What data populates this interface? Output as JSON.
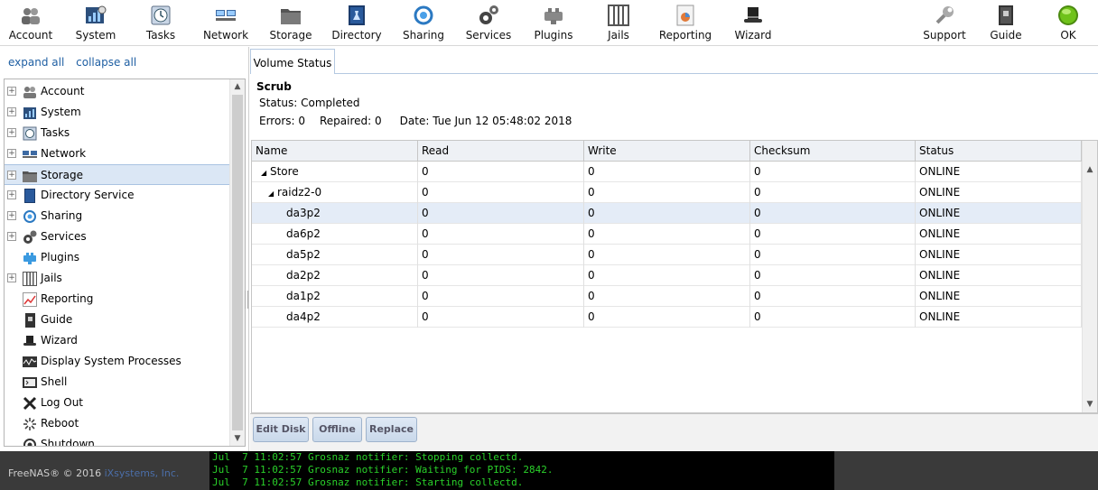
{
  "toolbar": {
    "items": [
      {
        "label": "Account",
        "icon": "account-icon"
      },
      {
        "label": "System",
        "icon": "system-icon"
      },
      {
        "label": "Tasks",
        "icon": "tasks-icon"
      },
      {
        "label": "Network",
        "icon": "network-icon"
      },
      {
        "label": "Storage",
        "icon": "storage-icon"
      },
      {
        "label": "Directory",
        "icon": "directory-icon"
      },
      {
        "label": "Sharing",
        "icon": "sharing-icon"
      },
      {
        "label": "Services",
        "icon": "services-icon"
      },
      {
        "label": "Plugins",
        "icon": "plugins-icon"
      },
      {
        "label": "Jails",
        "icon": "jails-icon"
      },
      {
        "label": "Reporting",
        "icon": "reporting-icon"
      },
      {
        "label": "Wizard",
        "icon": "wizard-icon"
      },
      {
        "label": "Support",
        "icon": "support-icon"
      },
      {
        "label": "Guide",
        "icon": "guide-icon"
      },
      {
        "label": "OK",
        "icon": "status-ok-icon"
      }
    ]
  },
  "sidebar": {
    "expand_all": "expand all",
    "collapse_all": "collapse all",
    "items": [
      {
        "label": "Account",
        "expandable": "+"
      },
      {
        "label": "System",
        "expandable": "+"
      },
      {
        "label": "Tasks",
        "expandable": "+"
      },
      {
        "label": "Network",
        "expandable": "+"
      },
      {
        "label": "Storage",
        "expandable": "+"
      },
      {
        "label": "Directory Service",
        "expandable": "+"
      },
      {
        "label": "Sharing",
        "expandable": "+"
      },
      {
        "label": "Services",
        "expandable": "+"
      },
      {
        "label": "Plugins",
        "expandable": ""
      },
      {
        "label": "Jails",
        "expandable": "+"
      },
      {
        "label": "Reporting",
        "expandable": ""
      },
      {
        "label": "Guide",
        "expandable": ""
      },
      {
        "label": "Wizard",
        "expandable": ""
      },
      {
        "label": "Display System Processes",
        "expandable": ""
      },
      {
        "label": "Shell",
        "expandable": ""
      },
      {
        "label": "Log Out",
        "expandable": ""
      },
      {
        "label": "Reboot",
        "expandable": ""
      },
      {
        "label": "Shutdown",
        "expandable": ""
      }
    ],
    "selected": "Storage"
  },
  "main": {
    "tab_label": "Volume Status",
    "scrub": {
      "title": "Scrub",
      "status": "Status: Completed",
      "errors": "Errors: 0",
      "repaired": "Repaired: 0",
      "date": "Date: Tue Jun 12 05:48:02 2018"
    },
    "grid": {
      "columns": [
        "Name",
        "Read",
        "Write",
        "Checksum",
        "Status"
      ],
      "rows": [
        {
          "name": "Store",
          "tree": "◢",
          "read": "0",
          "write": "0",
          "checksum": "0",
          "status": "ONLINE"
        },
        {
          "name": "raidz2-0",
          "tree": "◢",
          "read": "0",
          "write": "0",
          "checksum": "0",
          "status": "ONLINE"
        },
        {
          "name": "da3p2",
          "tree": "",
          "read": "0",
          "write": "0",
          "checksum": "0",
          "status": "ONLINE"
        },
        {
          "name": "da6p2",
          "tree": "",
          "read": "0",
          "write": "0",
          "checksum": "0",
          "status": "ONLINE"
        },
        {
          "name": "da5p2",
          "tree": "",
          "read": "0",
          "write": "0",
          "checksum": "0",
          "status": "ONLINE"
        },
        {
          "name": "da2p2",
          "tree": "",
          "read": "0",
          "write": "0",
          "checksum": "0",
          "status": "ONLINE"
        },
        {
          "name": "da1p2",
          "tree": "",
          "read": "0",
          "write": "0",
          "checksum": "0",
          "status": "ONLINE"
        },
        {
          "name": "da4p2",
          "tree": "",
          "read": "0",
          "write": "0",
          "checksum": "0",
          "status": "ONLINE"
        }
      ],
      "selected_row": "da3p2"
    },
    "buttons": {
      "edit_disk": "Edit Disk",
      "offline": "Offline",
      "replace": "Replace"
    }
  },
  "footer": {
    "copyright": "FreeNAS® © 2016",
    "company": "iXsystems, Inc.",
    "console_lines": [
      "Jul  7 11:02:57 Grosnaz notifier: Stopping collectd.",
      "Jul  7 11:02:57 Grosnaz notifier: Waiting for PIDS: 2842.",
      "Jul  7 11:02:57 Grosnaz notifier: Starting collectd."
    ]
  },
  "colors": {
    "link": "#1f5fa3",
    "selection": "#dbe7f5",
    "console_text": "#2ad12a",
    "status_ok": "#6fc21a"
  }
}
